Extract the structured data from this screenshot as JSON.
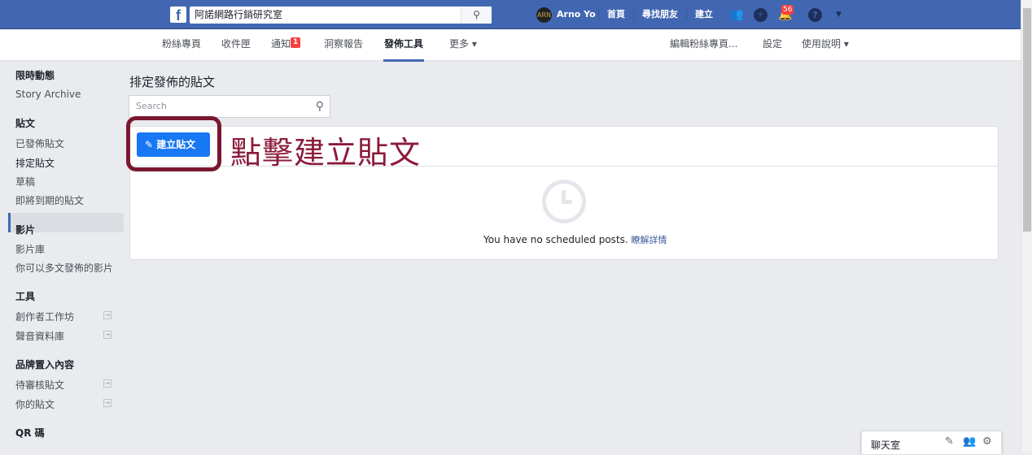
{
  "topbar": {
    "page_name": "阿諾網路行銷研究室",
    "user_name": "Arno Yo",
    "nav": [
      "首頁",
      "尋找朋友",
      "建立"
    ],
    "notification_count": "56",
    "brand_color": "#4267b2"
  },
  "subnav": {
    "tabs": [
      "粉絲專頁",
      "收件匣",
      "通知",
      "洞察報告",
      "發佈工具",
      "更多 ▾"
    ],
    "notify_badge": "1",
    "active": "發佈工具",
    "right": [
      "編輯粉絲專頁...",
      "設定",
      "使用說明 ▾"
    ]
  },
  "sidebar": {
    "items": [
      "限時動態",
      "Story Archive",
      "貼文",
      "已發佈貼文",
      "排定貼文",
      "草稿",
      "即將到期的貼文",
      "影片",
      "影片庫",
      "你可以多文發佈的影片",
      "工具",
      "創作者工作坊",
      "聲音資料庫",
      "品牌置入內容",
      "待審核貼文",
      "你的貼文",
      "QR 碼"
    ],
    "selected": "排定貼文"
  },
  "main": {
    "title": "排定發佈的貼文",
    "search_placeholder": "Search",
    "create_button": "建立貼文",
    "annotation": "點擊建立貼文",
    "annotation_color": "#8b1a3a",
    "empty_text": "You have no scheduled posts.",
    "learn_more": "瞭解詳情"
  },
  "chat": {
    "title": "聊天室"
  }
}
